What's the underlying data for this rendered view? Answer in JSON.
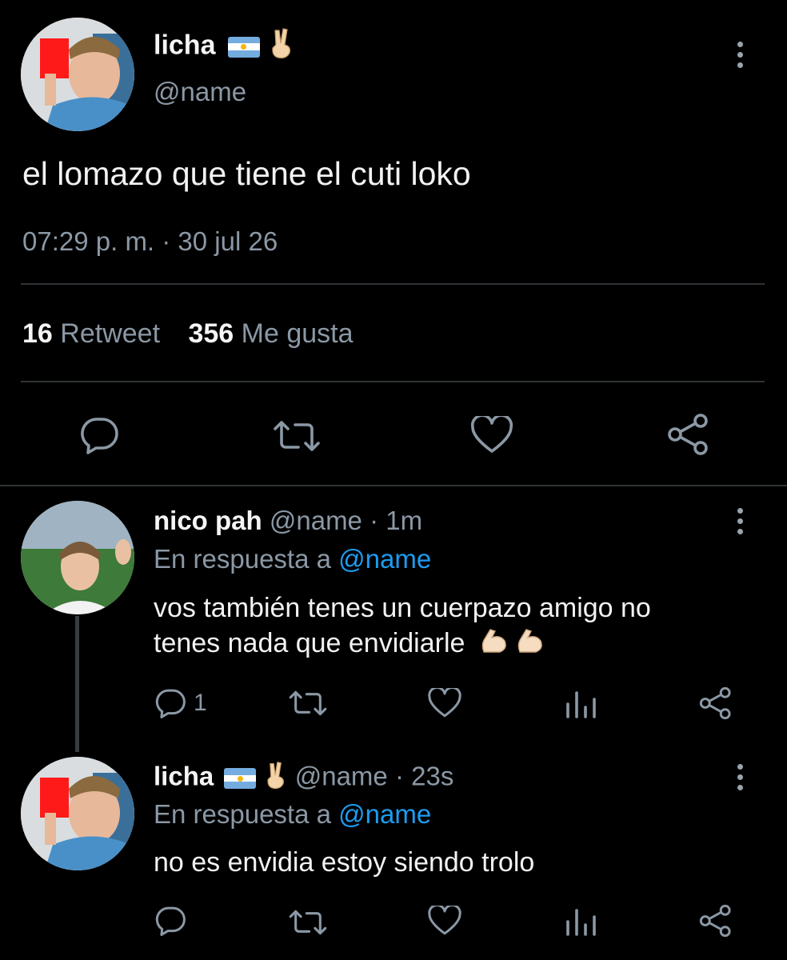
{
  "main_tweet": {
    "display_name": "licha",
    "handle": "@name",
    "text": "el lomazo que tiene el cuti loko",
    "timestamp": "07:29 p. m. · 30 jul 26",
    "retweet_count": "16",
    "retweet_label": "Retweet",
    "like_count": "356",
    "like_label": "Me gusta"
  },
  "replies": [
    {
      "display_name": "nico pah",
      "handle": "@name",
      "time": "· 1m",
      "reply_prefix": "En respuesta a",
      "reply_to": "@name",
      "text_line1": "vos también tenes un cuerpazo amigo no",
      "text_line2": "tenes nada que envidiarle",
      "reply_count": "1"
    },
    {
      "display_name": "licha",
      "handle": "@name",
      "time": "· 23s",
      "reply_prefix": "En respuesta a",
      "reply_to": "@name",
      "text": "no es envidia estoy siendo trolo"
    }
  ],
  "icons": [
    "flag-argentina-icon",
    "victory-hand-icon",
    "more-options-icon",
    "reply-icon",
    "retweet-icon",
    "like-icon",
    "share-icon",
    "analytics-icon",
    "flexed-biceps-icon"
  ],
  "colors": {
    "background": "#000000",
    "text": "#e7e9ea",
    "secondary": "#8b98a5",
    "link": "#1d9bf0",
    "divider": "#2f3336"
  }
}
